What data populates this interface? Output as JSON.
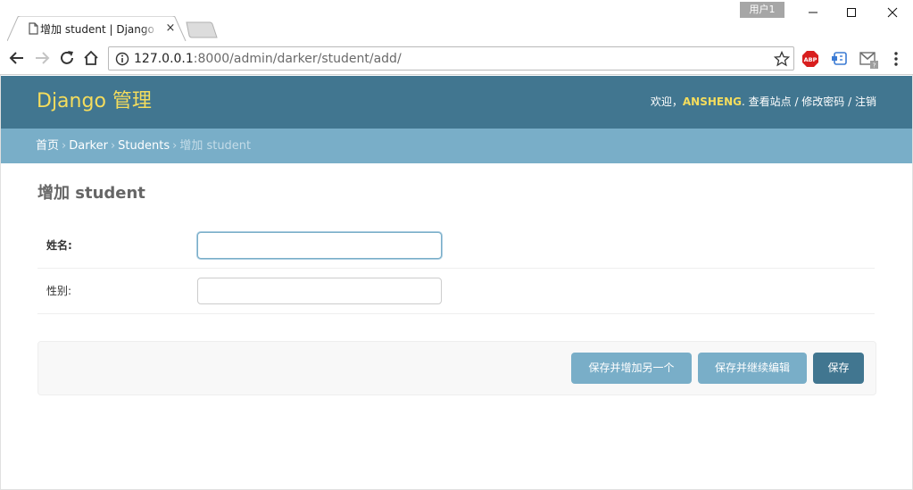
{
  "browser": {
    "tab": {
      "title": "增加 student | Django 站点管理",
      "close_glyph": "×"
    },
    "profile_label": "用户1",
    "url": {
      "host": "127.0.0.1",
      "path": ":8000/admin/darker/student/add/"
    },
    "icons": {
      "back": "arrow-left-icon",
      "forward": "arrow-right-icon",
      "reload": "reload-icon",
      "home": "home-icon",
      "info": "info-icon",
      "bookmark": "star-icon",
      "adblock": "adblock-icon",
      "extension": "extension-icon",
      "gmail": "gmail-icon",
      "menu": "kebab-menu-icon"
    },
    "adblock_label": "ABP"
  },
  "admin": {
    "brand": "Django 管理",
    "user_tools": {
      "welcome": "欢迎，",
      "username": "ANSHENG",
      "view_site": "查看站点",
      "change_password": "修改密码",
      "logout": "注销",
      "separator": " / "
    },
    "breadcrumbs": {
      "home": "首页",
      "app": "Darker",
      "model": "Students",
      "current": "增加 student",
      "separator": "›"
    },
    "page_title": "增加 student",
    "form": {
      "fields": [
        {
          "label": "姓名:",
          "value": "",
          "required": true,
          "focused": true
        },
        {
          "label": "性别:",
          "value": "",
          "required": false,
          "focused": false
        }
      ]
    },
    "buttons": {
      "save_and_add_another": "保存并增加另一个",
      "save_and_continue": "保存并继续编辑",
      "save": "保存"
    }
  },
  "colors": {
    "header_bg": "#417690",
    "breadcrumb_bg": "#79aec8",
    "brand_yellow": "#f5dd5d",
    "primary_button": "#417690",
    "secondary_button": "#79aec8"
  }
}
